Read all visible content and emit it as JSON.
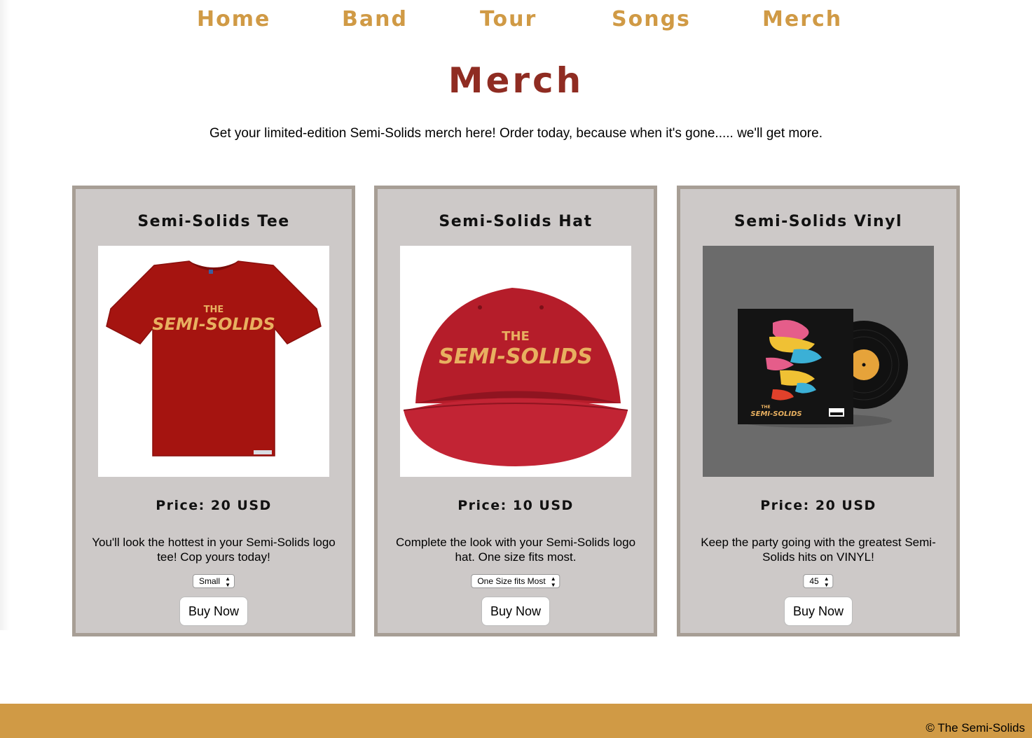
{
  "nav": {
    "items": [
      {
        "label": "Home"
      },
      {
        "label": "Band"
      },
      {
        "label": "Tour"
      },
      {
        "label": "Songs"
      },
      {
        "label": "Merch"
      }
    ]
  },
  "page": {
    "title": "Merch",
    "intro": "Get your limited-edition Semi-Solids merch here! Order today, because when it's gone..... we'll get more."
  },
  "products": [
    {
      "title": "Semi-Solids Tee",
      "price": "Price: 20 USD",
      "description": "You'll look the hottest in your Semi-Solids logo tee! Cop yours today!",
      "option": "Small",
      "button": "Buy Now",
      "logo_top": "THE",
      "logo_main": "SEMI-SOLIDS"
    },
    {
      "title": "Semi-Solids Hat",
      "price": "Price: 10 USD",
      "description": "Complete the look with your Semi-Solids logo hat. One size fits most.",
      "option": "One Size fits Most",
      "button": "Buy Now",
      "logo_top": "THE",
      "logo_main": "SEMI-SOLIDS"
    },
    {
      "title": "Semi-Solids Vinyl",
      "price": "Price: 20 USD",
      "description": "Keep the party going with the greatest Semi-Solids hits on VINYL!",
      "option": "45",
      "button": "Buy Now",
      "logo_top": "THE",
      "logo_main": "SEMI-SOLIDS"
    }
  ],
  "footer": {
    "text": "© The Semi-Solids"
  },
  "colors": {
    "accent_gold": "#d09a45",
    "title_red": "#8f2c22",
    "card_bg": "#cdc9c8",
    "card_border": "#a79e95",
    "shirt_red": "#a51410",
    "hat_red": "#b51d2a"
  }
}
